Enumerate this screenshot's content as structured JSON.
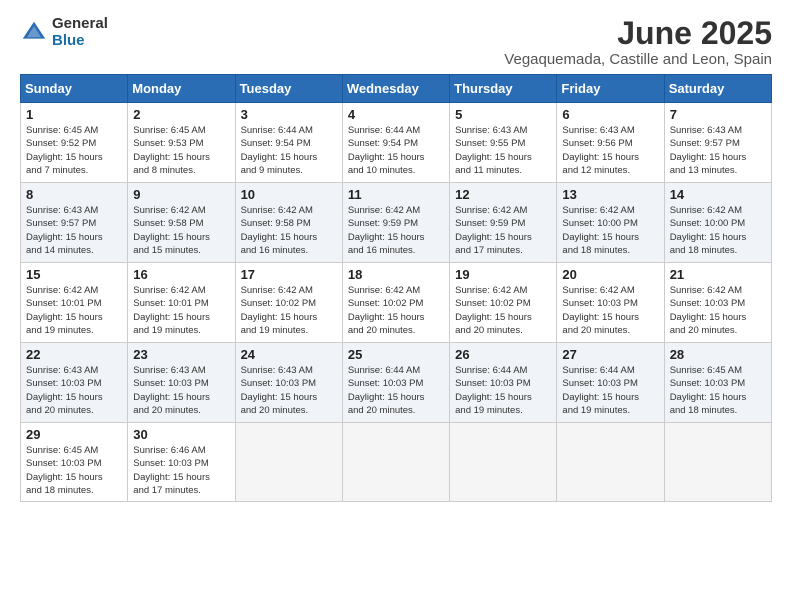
{
  "logo": {
    "general": "General",
    "blue": "Blue"
  },
  "title": "June 2025",
  "subtitle": "Vegaquemada, Castille and Leon, Spain",
  "days_header": [
    "Sunday",
    "Monday",
    "Tuesday",
    "Wednesday",
    "Thursday",
    "Friday",
    "Saturday"
  ],
  "weeks": [
    [
      {
        "day": 1,
        "sunrise": "6:45 AM",
        "sunset": "9:52 PM",
        "daylight": "15 hours and 7 minutes."
      },
      {
        "day": 2,
        "sunrise": "6:45 AM",
        "sunset": "9:53 PM",
        "daylight": "15 hours and 8 minutes."
      },
      {
        "day": 3,
        "sunrise": "6:44 AM",
        "sunset": "9:54 PM",
        "daylight": "15 hours and 9 minutes."
      },
      {
        "day": 4,
        "sunrise": "6:44 AM",
        "sunset": "9:54 PM",
        "daylight": "15 hours and 10 minutes."
      },
      {
        "day": 5,
        "sunrise": "6:43 AM",
        "sunset": "9:55 PM",
        "daylight": "15 hours and 11 minutes."
      },
      {
        "day": 6,
        "sunrise": "6:43 AM",
        "sunset": "9:56 PM",
        "daylight": "15 hours and 12 minutes."
      },
      {
        "day": 7,
        "sunrise": "6:43 AM",
        "sunset": "9:57 PM",
        "daylight": "15 hours and 13 minutes."
      }
    ],
    [
      {
        "day": 8,
        "sunrise": "6:43 AM",
        "sunset": "9:57 PM",
        "daylight": "15 hours and 14 minutes."
      },
      {
        "day": 9,
        "sunrise": "6:42 AM",
        "sunset": "9:58 PM",
        "daylight": "15 hours and 15 minutes."
      },
      {
        "day": 10,
        "sunrise": "6:42 AM",
        "sunset": "9:58 PM",
        "daylight": "15 hours and 16 minutes."
      },
      {
        "day": 11,
        "sunrise": "6:42 AM",
        "sunset": "9:59 PM",
        "daylight": "15 hours and 16 minutes."
      },
      {
        "day": 12,
        "sunrise": "6:42 AM",
        "sunset": "9:59 PM",
        "daylight": "15 hours and 17 minutes."
      },
      {
        "day": 13,
        "sunrise": "6:42 AM",
        "sunset": "10:00 PM",
        "daylight": "15 hours and 18 minutes."
      },
      {
        "day": 14,
        "sunrise": "6:42 AM",
        "sunset": "10:00 PM",
        "daylight": "15 hours and 18 minutes."
      }
    ],
    [
      {
        "day": 15,
        "sunrise": "6:42 AM",
        "sunset": "10:01 PM",
        "daylight": "15 hours and 19 minutes."
      },
      {
        "day": 16,
        "sunrise": "6:42 AM",
        "sunset": "10:01 PM",
        "daylight": "15 hours and 19 minutes."
      },
      {
        "day": 17,
        "sunrise": "6:42 AM",
        "sunset": "10:02 PM",
        "daylight": "15 hours and 19 minutes."
      },
      {
        "day": 18,
        "sunrise": "6:42 AM",
        "sunset": "10:02 PM",
        "daylight": "15 hours and 20 minutes."
      },
      {
        "day": 19,
        "sunrise": "6:42 AM",
        "sunset": "10:02 PM",
        "daylight": "15 hours and 20 minutes."
      },
      {
        "day": 20,
        "sunrise": "6:42 AM",
        "sunset": "10:03 PM",
        "daylight": "15 hours and 20 minutes."
      },
      {
        "day": 21,
        "sunrise": "6:42 AM",
        "sunset": "10:03 PM",
        "daylight": "15 hours and 20 minutes."
      }
    ],
    [
      {
        "day": 22,
        "sunrise": "6:43 AM",
        "sunset": "10:03 PM",
        "daylight": "15 hours and 20 minutes."
      },
      {
        "day": 23,
        "sunrise": "6:43 AM",
        "sunset": "10:03 PM",
        "daylight": "15 hours and 20 minutes."
      },
      {
        "day": 24,
        "sunrise": "6:43 AM",
        "sunset": "10:03 PM",
        "daylight": "15 hours and 20 minutes."
      },
      {
        "day": 25,
        "sunrise": "6:44 AM",
        "sunset": "10:03 PM",
        "daylight": "15 hours and 20 minutes."
      },
      {
        "day": 26,
        "sunrise": "6:44 AM",
        "sunset": "10:03 PM",
        "daylight": "15 hours and 19 minutes."
      },
      {
        "day": 27,
        "sunrise": "6:44 AM",
        "sunset": "10:03 PM",
        "daylight": "15 hours and 19 minutes."
      },
      {
        "day": 28,
        "sunrise": "6:45 AM",
        "sunset": "10:03 PM",
        "daylight": "15 hours and 18 minutes."
      }
    ],
    [
      {
        "day": 29,
        "sunrise": "6:45 AM",
        "sunset": "10:03 PM",
        "daylight": "15 hours and 18 minutes."
      },
      {
        "day": 30,
        "sunrise": "6:46 AM",
        "sunset": "10:03 PM",
        "daylight": "15 hours and 17 minutes."
      },
      null,
      null,
      null,
      null,
      null
    ]
  ]
}
